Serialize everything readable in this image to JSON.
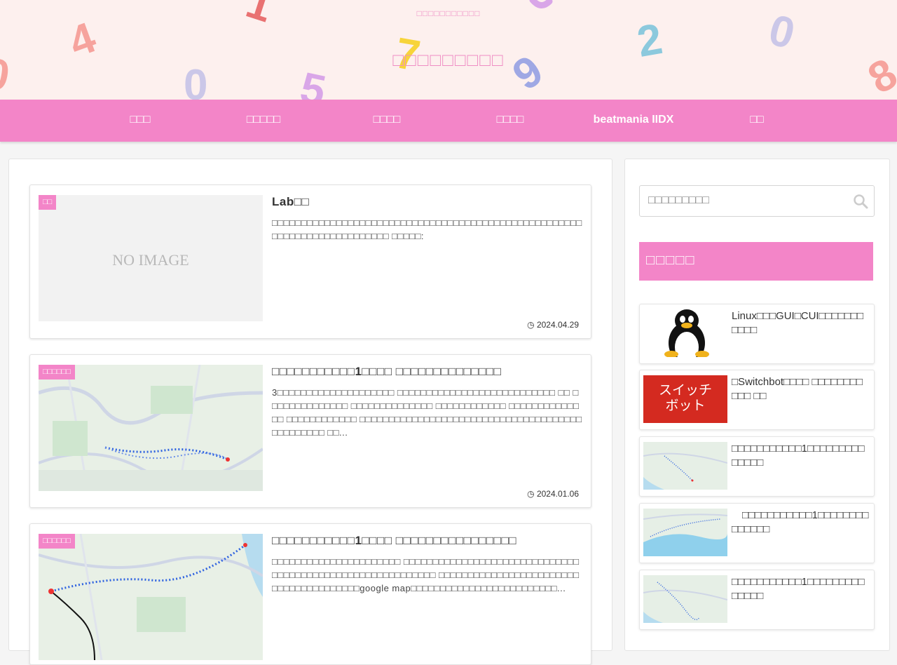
{
  "header": {
    "tagline": "□□□□□□□□□□□",
    "site_title": "□□□□□□□□□",
    "bg_color": "#fdf0ee",
    "decor_digits": [
      "1",
      "4",
      "0",
      "5",
      "7",
      "9",
      "2",
      "0",
      "8",
      "0"
    ]
  },
  "nav": {
    "bg_color": "#f385c8",
    "items": [
      {
        "label": "□□□"
      },
      {
        "label": "□□□□□"
      },
      {
        "label": "□□□□"
      },
      {
        "label": "□□□□"
      },
      {
        "label": "beatmania IIDX"
      },
      {
        "label": "□□"
      }
    ]
  },
  "posts": [
    {
      "category": "□□",
      "title": "Lab□□",
      "excerpt": "□□□□□□□□□□□□□□□□□□□□□□□□□□□□□□□□□□□□□□□□□□□□□□□□□□□□□□□□□□□□□□□□□□□□□□□□□ □□□□□:",
      "date": "2024.04.29",
      "thumb": "no-image",
      "noimage_text": "NO IMAGE"
    },
    {
      "category": "□□□□□□",
      "title": "□□□□□□□□□□□1□□□□ □□□□□□□□□□□□□□",
      "excerpt": "3□□□□□□□□□□□□□□□□□□□□ □□□□□□□□□□□□□□□□□□□□□□□□□□□ □□ □□□□□□□□□□□□□□ □□□□□□□□□□□□□□ □□□□□□□□□□□□ □□□□□□□□□□□□□□ □□□□□□□□□□□□ □□□□□□□□□□□□□□□□□□□□□□□□□□□□□□□□□□□□□□□□□□□□□□□ □□...",
      "date": "2024.01.06",
      "thumb": "map-route-1"
    },
    {
      "category": "□□□□□□",
      "title": "□□□□□□□□□□□1□□□□ □□□□□□□□□□□□□□□□",
      "excerpt": "□□□□□□□□□□□□□□□□□□□□□□ □□□□□□□□□□□□□□□□□□□□□□□□□□□□□□□□□□□□□□□□□□□□□□□□□□□□□□□□□□ □□□□□□□□□□□□□□□□□□□□□□□□□□□□□□□□□□□□□□□google map□□□□□□□□□□□□□□□□□□□□□□□□□...",
      "date": "",
      "thumb": "map-route-2"
    }
  ],
  "sidebar": {
    "search_placeholder": "□□□□□□□□□",
    "popular_heading": "□□□□□",
    "popular": [
      {
        "title": "Linux□□□GUI□CUI□□□□□□□□□□□",
        "thumb": "tux"
      },
      {
        "title": "□Switchbot□□□□ □□□□□□□□□□□ □□",
        "thumb": "switchbot",
        "thumb_text": "スイッチ\nボット"
      },
      {
        "title": "□□□□□□□□□□□1□□□□□□□□□□□□□□",
        "thumb": "map"
      },
      {
        "title": "　□□□□□□□□□□□1□□□□□□□□□□□□□□",
        "thumb": "map-coast"
      },
      {
        "title": "□□□□□□□□□□□1□□□□□□□□□□□□□□",
        "thumb": "map"
      }
    ]
  },
  "colors": {
    "accent": "#f385c8",
    "title_pink": "#ef8dc4",
    "page_bg": "#f5f5f5"
  }
}
